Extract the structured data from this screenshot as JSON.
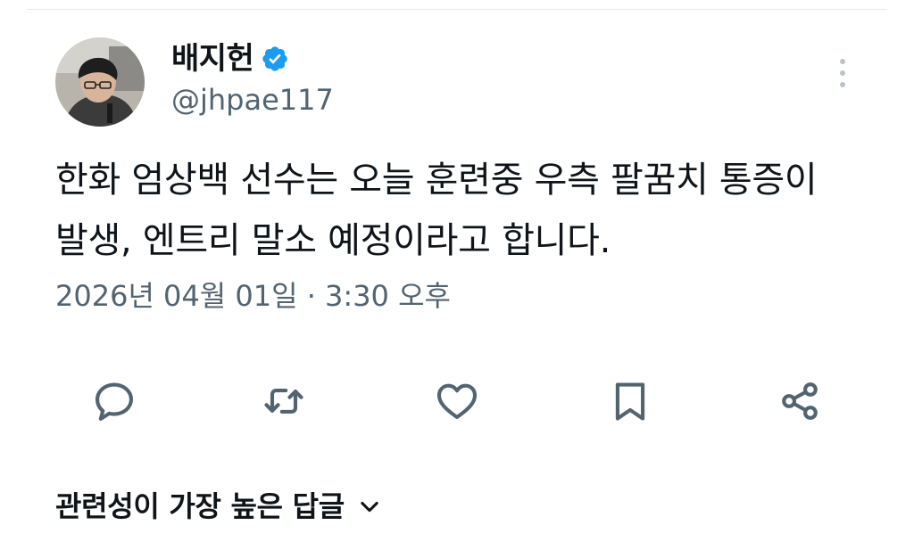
{
  "author": {
    "display_name": "배지헌",
    "handle": "@jhpae117",
    "verified": true,
    "avatar_icon": "profile-photo"
  },
  "tweet": {
    "text_lines": [
      "한화 엄상백 선수는 오늘 훈련중 우측 팔꿈치 통증이",
      "발생, 엔트리 말소 예정이라고 합니다."
    ],
    "timestamp": "2026년 04월 01일 · 3:30 오후"
  },
  "actions": [
    {
      "name": "reply",
      "icon": "speech-bubble-icon"
    },
    {
      "name": "retweet",
      "icon": "retweet-icon"
    },
    {
      "name": "like",
      "icon": "heart-icon"
    },
    {
      "name": "bookmark",
      "icon": "bookmark-icon"
    },
    {
      "name": "share",
      "icon": "share-icon"
    }
  ],
  "replies_sort": {
    "label": "관련성이 가장 높은 답글",
    "icon": "chevron-down-icon"
  },
  "colors": {
    "text": "#0f1419",
    "secondary": "#536471",
    "verified": "#1d9bf0",
    "divider": "#e7e9ea"
  }
}
